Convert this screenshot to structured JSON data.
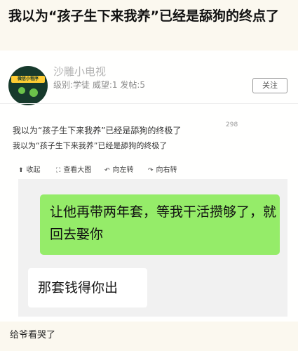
{
  "title": "我以为“孩子生下来我养”已经是舔狗的终点了",
  "user": {
    "name": "沙雕小电视",
    "meta": "级别:学徒  威望:1  发帖:5",
    "avatar_text": "微信小程序",
    "follow_label": "关注"
  },
  "post": {
    "title": "我以为“孩子生下来我养”已经是舔狗的终极了",
    "count": "298",
    "subtitle": "我以为“孩子生下来我养”已经是舔狗的终极了"
  },
  "toolbar": {
    "items": [
      {
        "icon": "arrow-up-icon",
        "label": "收起"
      },
      {
        "icon": "zoom-icon",
        "label": "查看大图"
      },
      {
        "icon": "rotate-left-icon",
        "label": "向左转"
      },
      {
        "icon": "rotate-right-icon",
        "label": "向右转"
      }
    ]
  },
  "chat": {
    "messages": [
      {
        "side": "right",
        "text": "让他再带两年套，等我干活攒够了，就回去娶你"
      },
      {
        "side": "left",
        "text": "那套钱得你出"
      }
    ]
  },
  "footer_text": "给爷看哭了"
}
